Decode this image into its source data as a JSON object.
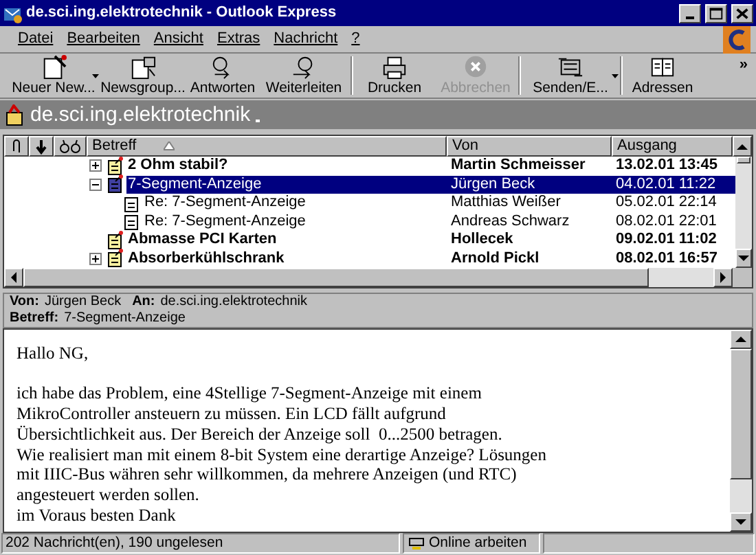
{
  "window": {
    "title": "de.sci.ing.elektrotechnik - Outlook Express"
  },
  "menu": [
    "Datei",
    "Bearbeiten",
    "Ansicht",
    "Extras",
    "Nachricht",
    "?"
  ],
  "toolbar": [
    {
      "label": "Neuer New...",
      "dropdown": true,
      "disabled": false
    },
    {
      "label": "Newsgroup...",
      "dropdown": false,
      "disabled": false
    },
    {
      "label": "Antworten",
      "dropdown": false,
      "disabled": false
    },
    {
      "label": "Weiterleiten",
      "dropdown": false,
      "disabled": false
    },
    {
      "label": "Drucken",
      "dropdown": false,
      "disabled": false
    },
    {
      "label": "Abbrechen",
      "dropdown": false,
      "disabled": true
    },
    {
      "label": "Senden/E...",
      "dropdown": true,
      "disabled": false
    },
    {
      "label": "Adressen",
      "dropdown": false,
      "disabled": false
    }
  ],
  "overflow": "»",
  "folder": {
    "name": "de.sci.ing.elektrotechnik"
  },
  "list": {
    "columns": [
      "Betreff",
      "Von",
      "Ausgang"
    ],
    "rows": [
      {
        "subject": "2 Ohm stabil?",
        "from": "Martin Schmeisser",
        "date": "13.02.01 13:45",
        "unread": true,
        "selected": false,
        "expandable": true,
        "expanded": false
      },
      {
        "subject": "7-Segment-Anzeige",
        "from": "Jürgen Beck",
        "date": "04.02.01 11:22",
        "unread": false,
        "selected": true,
        "expandable": true,
        "expanded": true,
        "children": [
          {
            "subject": "Re: 7-Segment-Anzeige",
            "from": "Matthias Weißer",
            "date": "05.02.01 22:14",
            "unread": false,
            "selected": false,
            "expandable": false
          },
          {
            "subject": "Re: 7-Segment-Anzeige",
            "from": "Andreas Schwarz",
            "date": "08.02.01 22:01",
            "unread": false,
            "selected": false,
            "expandable": false
          }
        ]
      },
      {
        "subject": "Abmasse PCI Karten",
        "from": "Hollecek",
        "date": "09.02.01 11:02",
        "unread": true,
        "selected": false,
        "expandable": false
      },
      {
        "subject": "Absorberkühlschrank",
        "from": "Arnold Pickl",
        "date": "08.02.01 16:57",
        "unread": true,
        "selected": false,
        "expandable": true,
        "expanded": false
      }
    ]
  },
  "preview": {
    "from_label": "Von:",
    "from": "Jürgen Beck",
    "to_label": "An:",
    "to": "de.sci.ing.elektrotechnik",
    "subject_label": "Betreff:",
    "subject": "7-Segment-Anzeige",
    "body": [
      [
        "Hallo NG,"
      ],
      [
        "ich habe das Problem, eine 4Stellige 7-Segment-Anzeige mit einem",
        "MikroController ansteuern zu müssen. Ein LCD fällt aufgrund",
        "Übersichtlichkeit aus. Der Bereich der Anzeige soll  0...2500 betragen.",
        "Wie realisiert man mit einem 8-bit System eine derartige Anzeige? Lösungen",
        "mit IIIC-Bus währen sehr willkommen, da mehrere Anzeigen (und RTC)",
        "angesteuert werden sollen.",
        "im Voraus besten Dank"
      ]
    ]
  },
  "status_bar": {
    "count": "202 Nachricht(en), 190 ungelesen",
    "mode": "Online arbeiten"
  }
}
